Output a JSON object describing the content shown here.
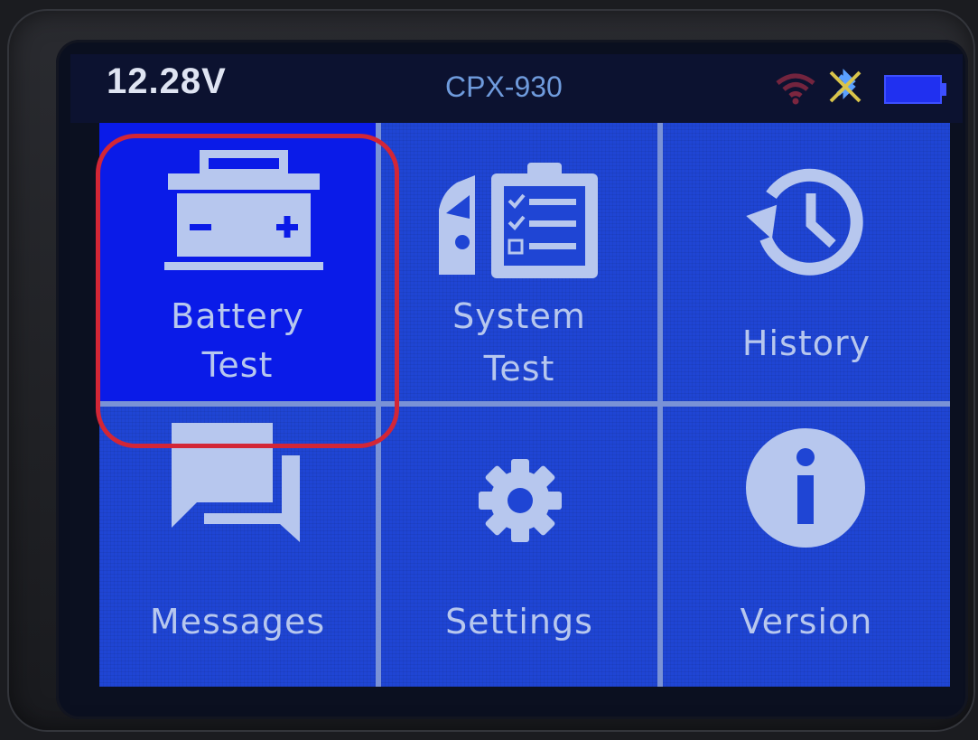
{
  "status_bar": {
    "voltage": "12.28V",
    "model": "CPX-930",
    "wifi_icon": "wifi-icon",
    "bluetooth_icon": "bluetooth-off-icon",
    "battery_icon": "battery-icon"
  },
  "menu": {
    "items": [
      {
        "label_lines": [
          "Battery",
          "Test"
        ],
        "icon": "car-battery-icon",
        "selected": true
      },
      {
        "label_lines": [
          "System",
          "Test"
        ],
        "icon": "vehicle-checklist-icon",
        "selected": false
      },
      {
        "label_lines": [
          "History"
        ],
        "icon": "history-icon",
        "selected": false
      },
      {
        "label_lines": [
          "Messages"
        ],
        "icon": "chat-bubbles-icon",
        "selected": false
      },
      {
        "label_lines": [
          "Settings"
        ],
        "icon": "gear-icon",
        "selected": false
      },
      {
        "label_lines": [
          "Version"
        ],
        "icon": "info-icon",
        "selected": false
      }
    ]
  },
  "colors": {
    "tile": "#1f45d4",
    "tile_selected": "#0a1be8",
    "highlight": "#d32636",
    "icon": "#b7c7ee"
  }
}
